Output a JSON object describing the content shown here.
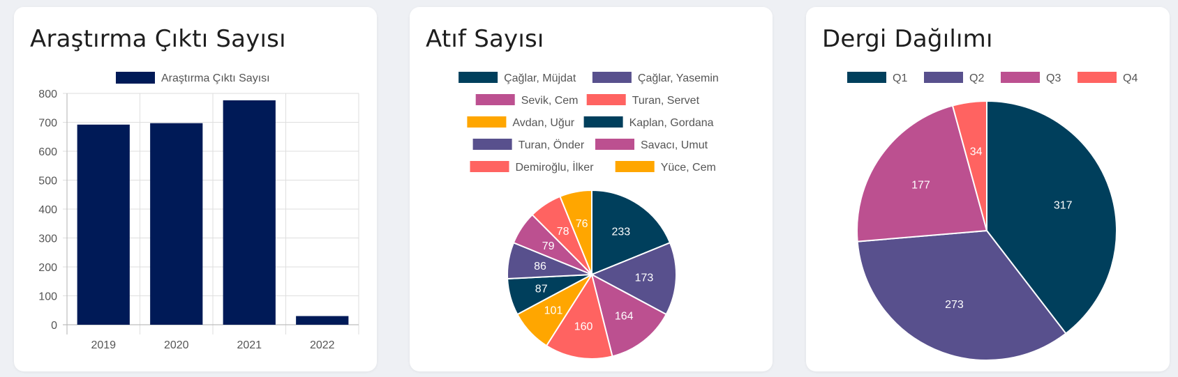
{
  "colors": {
    "bar": "#001a57",
    "grid": "#dedede",
    "axis_text": "#555555",
    "legend_text": "#555555",
    "pie_palette": [
      "#003f5c",
      "#58508d",
      "#bc5090",
      "#ff6361",
      "#ffa600"
    ]
  },
  "cards": [
    {
      "title": "Araştırma Çıktı Sayısı"
    },
    {
      "title": "Atıf Sayısı"
    },
    {
      "title": "Dergi Dağılımı"
    }
  ],
  "chart_data": [
    {
      "type": "bar",
      "title": "Araştırma Çıktı Sayısı",
      "categories": [
        "2019",
        "2020",
        "2021",
        "2022"
      ],
      "series": [
        {
          "name": "Araştırma Çıktı Sayısı",
          "values": [
            692,
            697,
            776,
            30
          ]
        }
      ],
      "ylim": [
        0,
        800
      ],
      "yticks": [
        0,
        100,
        200,
        300,
        400,
        500,
        600,
        700,
        800
      ],
      "grid": true,
      "legend": "top"
    },
    {
      "type": "pie",
      "title": "Atıf Sayısı",
      "labels": [
        "Çağlar, Müjdat",
        "Çağlar, Yasemin",
        "Sevik, Cem",
        "Turan, Servet",
        "Avdan, Uğur",
        "Kaplan, Gordana",
        "Turan, Önder",
        "Savacı, Umut",
        "Demiroğlu, İlker",
        "Yüce, Cem"
      ],
      "values": [
        233,
        173,
        164,
        160,
        101,
        87,
        86,
        79,
        78,
        76
      ],
      "legend": "top"
    },
    {
      "type": "pie",
      "title": "Dergi Dağılımı",
      "labels": [
        "Q1",
        "Q2",
        "Q3",
        "Q4"
      ],
      "values": [
        317,
        273,
        177,
        34
      ],
      "legend": "top"
    }
  ]
}
